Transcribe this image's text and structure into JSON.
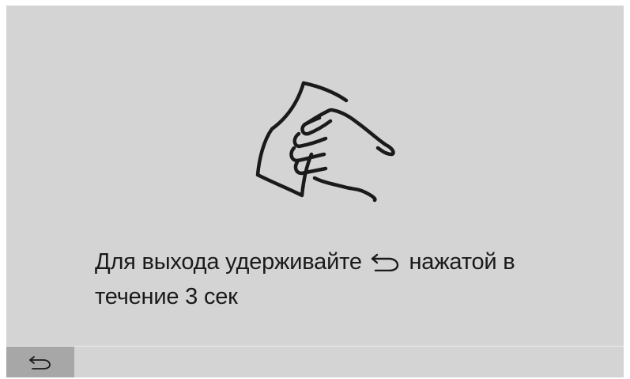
{
  "screen": {
    "hand_icon": "hand-press-icon",
    "message_part1": "Для выхода удерживайте",
    "message_part2": "нажатой в течение 3 сек",
    "inline_icon": "back-arrow-icon"
  },
  "bottom_bar": {
    "back_button_icon": "back-arrow-icon"
  },
  "colors": {
    "background": "#d4d4d4",
    "back_button": "#a7a7a7",
    "text": "#1a1a1a"
  }
}
